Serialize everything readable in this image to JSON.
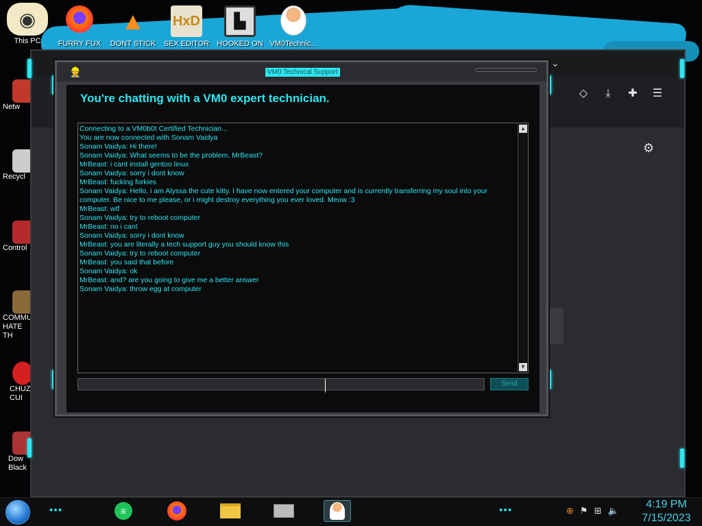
{
  "desktop": {
    "top_icons": [
      {
        "label": "This PC",
        "icon": "cartoon-character-icon"
      },
      {
        "label": "FURRY FUX",
        "icon": "firefox-icon"
      },
      {
        "label": "DONT STICK",
        "icon": "vlc-cone-icon"
      },
      {
        "label": "SEX EDITOR",
        "icon": "hxd-editor-icon"
      },
      {
        "label": "HOOKED ON",
        "icon": "maze-app-icon"
      },
      {
        "label": "VM0Technic...",
        "icon": "technician-icon"
      }
    ],
    "left_icons": [
      {
        "label": "Netw",
        "icon": "network-icon"
      },
      {
        "label": "Recycl",
        "icon": "recycle-bin-icon"
      },
      {
        "label": "Control",
        "icon": "control-panel-icon"
      },
      {
        "label": "COMMU HATE TH",
        "icon": "money-bag-icon"
      },
      {
        "label": "CHUZ CUI",
        "icon": "red-creature-icon"
      },
      {
        "label": "Dow Black",
        "icon": "download-icon"
      }
    ]
  },
  "browser": {
    "icons": [
      "pocket-icon",
      "download-icon",
      "extensions-icon",
      "menu-icon"
    ],
    "chevron": "chevron-down-icon",
    "settings": "gear-icon"
  },
  "chat_window": {
    "title": "VM0 Technical Support",
    "heading": "You're chatting with a VM0 expert technician.",
    "messages": [
      "Connecting to a VM0b0t Certified Technician...",
      "You are now connected with Sonam Vaidya",
      "Sonam Vaidya: Hi there!",
      "Sonam Vaidya: What seems to be the problem, MrBeast?",
      "MrBeast: i cant install gentoo linux",
      "Sonam Vaidya: sorry i dont know",
      "MrBeast: fucking forkies",
      "Sonam Vaidya: Hello, i am Alyssa the cute kitty. I have now entered your computer and is currently transferring my soul into your computer. Be nice to me please, or i might destroy everything you ever loved. Meow :3",
      "MrBeast: wtf",
      "Sonam Vaidya: try to reboot computer",
      "MrBeast: no i cant",
      "Sonam Vaidya: sorry i dont know",
      "MrBeast: you are literally a tech support guy you should know this",
      "Sonam Vaidya: try to reboot computer",
      "MrBeast: you said that before",
      "Sonam Vaidya: ok",
      "MrBeast: and? are you going to give me a better answer",
      "Sonam Vaidya: throw egg at computer"
    ],
    "input_value": "",
    "send_label": "Send"
  },
  "taskbar": {
    "apps": [
      "notes-app-icon",
      "firefox-icon",
      "file-explorer-icon",
      "printer-icon",
      "technician-icon"
    ],
    "active_app": "technician-icon",
    "tray": [
      "ime-icon",
      "flag-icon",
      "network-icon",
      "volume-icon"
    ],
    "time": "4:19 PM",
    "date": "7/15/2023"
  }
}
